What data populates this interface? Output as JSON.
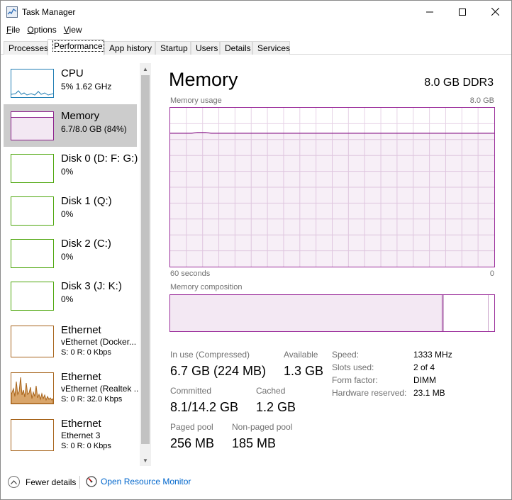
{
  "window": {
    "title": "Task Manager",
    "minimize": "—",
    "maximize": "☐",
    "close": "✕"
  },
  "menu": [
    {
      "label": "File",
      "accel": "F",
      "rest": "ile"
    },
    {
      "label": "Options",
      "accel": "O",
      "rest": "ptions"
    },
    {
      "label": "View",
      "accel": "V",
      "rest": "iew"
    }
  ],
  "tabs": [
    "Processes",
    "Performance",
    "App history",
    "Startup",
    "Users",
    "Details",
    "Services"
  ],
  "active_tab": "Performance",
  "resources": [
    {
      "title": "CPU",
      "sub": "5%  1.62 GHz",
      "color": "#1f7db3"
    },
    {
      "title": "Memory",
      "sub": "6.7/8.0 GB (84%)",
      "color": "#8b1f8b",
      "selected": true
    },
    {
      "title": "Disk 0 (D: F: G:)",
      "sub": "0%",
      "color": "#4da60c"
    },
    {
      "title": "Disk 1 (Q:)",
      "sub": "0%",
      "color": "#4da60c"
    },
    {
      "title": "Disk 2 (C:)",
      "sub": "0%",
      "color": "#4da60c"
    },
    {
      "title": "Disk 3 (J: K:)",
      "sub": "0%",
      "color": "#4da60c"
    },
    {
      "title": "Ethernet",
      "sub": "vEthernet (Docker...",
      "sub2": "S: 0  R: 0 Kbps",
      "color": "#a7641c"
    },
    {
      "title": "Ethernet",
      "sub": "vEthernet (Realtek ...",
      "sub2": "S: 0  R: 32.0 Kbps",
      "color": "#a7641c"
    },
    {
      "title": "Ethernet",
      "sub": "Ethernet 3",
      "sub2": "S: 0  R: 0 Kbps",
      "color": "#a7641c"
    }
  ],
  "panel": {
    "title": "Memory",
    "spec": "8.0 GB DDR3",
    "usage_label": "Memory usage",
    "usage_max": "8.0 GB",
    "time_left": "60 seconds",
    "time_right": "0",
    "composition_label": "Memory composition",
    "usage_fraction": 0.84,
    "accent": "#8b1f8b"
  },
  "stats": {
    "in_use_label": "In use (Compressed)",
    "in_use_value": "6.7 GB (224 MB)",
    "available_label": "Available",
    "available_value": "1.3 GB",
    "committed_label": "Committed",
    "committed_value": "8.1/14.2 GB",
    "cached_label": "Cached",
    "cached_value": "1.2 GB",
    "paged_label": "Paged pool",
    "paged_value": "256 MB",
    "nonpaged_label": "Non-paged pool",
    "nonpaged_value": "185 MB"
  },
  "details": [
    {
      "key": "Speed:",
      "value": "1333 MHz"
    },
    {
      "key": "Slots used:",
      "value": "2 of 4"
    },
    {
      "key": "Form factor:",
      "value": "DIMM"
    },
    {
      "key": "Hardware reserved:",
      "value": "23.1 MB"
    }
  ],
  "bottom": {
    "fewer_details": "Fewer details",
    "open_resource_monitor": "Open Resource Monitor"
  }
}
